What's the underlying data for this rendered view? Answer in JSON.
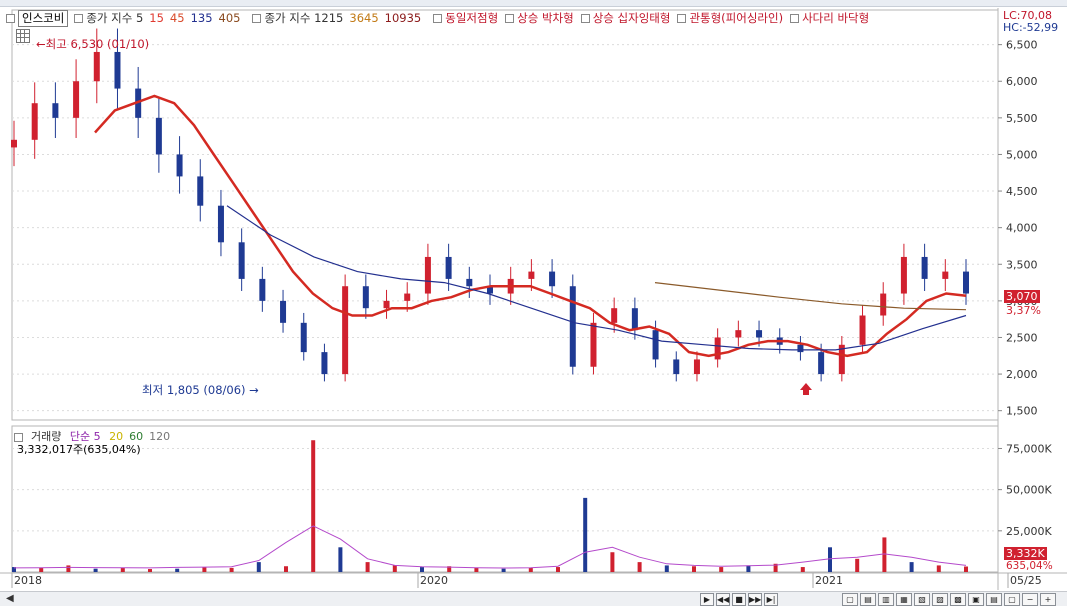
{
  "legend": {
    "stock_name": "인스코비",
    "price_ma_label": "종가 지수 5",
    "price_ma_periods": [
      {
        "label": "15",
        "color": "#e0392f"
      },
      {
        "label": "45",
        "color": "#d94a2a"
      },
      {
        "label": "135",
        "color": "#23308f"
      },
      {
        "label": "405",
        "color": "#8a4a1f"
      }
    ],
    "price_ma2_label": "종가 지수 1215",
    "price_ma2_periods": [
      {
        "label": "3645",
        "color": "#c27a15"
      },
      {
        "label": "10935",
        "color": "#8b1a1a"
      }
    ],
    "patterns": [
      "동일저점형",
      "상승 박차형",
      "상승 십자잉태형",
      "관통형(피어싱라인)",
      "사다리 바닥형"
    ]
  },
  "annotations": {
    "high": "최고 6,530 (01/10)",
    "low": "최저 1,805 (08/06)"
  },
  "right_axis": {
    "lc": "LC:70,08",
    "hc": "HC:-52,99",
    "price_ticks": [
      "6,500",
      "6,000",
      "5,500",
      "5,000",
      "4,500",
      "4,000",
      "3,500",
      "3,000",
      "2,500",
      "2,000",
      "1,500"
    ],
    "current_price": "3,070",
    "current_change": "3,37%",
    "volume_ticks": [
      "75,000K",
      "50,000K",
      "25,000K"
    ],
    "current_volume": "3,332K",
    "current_volume_ratio": "635,04%"
  },
  "volume_legend": {
    "label": "거래량",
    "ma_label": "단순 5",
    "periods": [
      {
        "label": "20",
        "color": "#c9b400"
      },
      {
        "label": "60",
        "color": "#2e7d32"
      },
      {
        "label": "120",
        "color": "#777777"
      }
    ],
    "value": "3,332,017주(635,04%)"
  },
  "x_axis": [
    "2018",
    "2020",
    "2021",
    "05/25"
  ],
  "colors": {
    "up": "#d0212f",
    "down": "#1f3a93",
    "ma_short": "#d42a22",
    "ma_mid": "#e07a20",
    "ma_long": "#23308f",
    "ma_very_long": "#8a5a2a"
  },
  "chart_data": {
    "type": "line",
    "title": "",
    "price_axis_range": [
      1400,
      6700
    ],
    "volume_axis_range": [
      0,
      85000
    ],
    "price_ticks": [
      6500,
      6000,
      5500,
      5000,
      4500,
      4000,
      3500,
      3000,
      2500,
      2000,
      1500
    ],
    "volume_ticks": [
      75000,
      50000,
      25000
    ],
    "series": [
      {
        "name": "종가",
        "values": [
          5200,
          5700,
          5500,
          6000,
          6400,
          5900,
          5500,
          5000,
          4700,
          4300,
          3800,
          3300,
          3000,
          2700,
          2300,
          2000,
          3200,
          2900,
          3000,
          3100,
          3600,
          3300,
          3200,
          3100,
          3300,
          3400,
          3200,
          2100,
          2700,
          2900,
          2600,
          2200,
          2000,
          2200,
          2500,
          2600,
          2500,
          2400,
          2300,
          2000,
          2400,
          2800,
          3100,
          3600,
          3300,
          3400,
          3100
        ]
      },
      {
        "name": "15",
        "values": [
          5300,
          5600,
          5700,
          5800,
          5700,
          5400,
          5000,
          4600,
          4200,
          3800,
          3400,
          3100,
          2900,
          2800,
          2800,
          2900,
          2900,
          3000,
          3050,
          3150,
          3200,
          3200,
          3200,
          3100,
          3000,
          2900,
          2700,
          2600,
          2650,
          2550,
          2300,
          2250,
          2300,
          2400,
          2450,
          2450,
          2400,
          2300,
          2250,
          2300,
          2550,
          2750,
          3000,
          3100,
          3070
        ]
      },
      {
        "name": "135",
        "values": [
          4300,
          3900,
          3600,
          3400,
          3300,
          3250,
          3100,
          2900,
          2700,
          2600,
          2450,
          2400,
          2350,
          2330,
          2330,
          2420,
          2620,
          2800
        ]
      },
      {
        "name": "405",
        "values": [
          3250,
          3150,
          3050,
          2960,
          2900,
          2880
        ]
      }
    ],
    "volume": {
      "name": "거래량",
      "values": [
        3000,
        2500,
        4000,
        2000,
        2500,
        1800,
        2000,
        3000,
        2500,
        6000,
        3500,
        80000,
        15000,
        6000,
        4000,
        3000,
        3500,
        2500,
        2000,
        2500,
        3000,
        45000,
        12000,
        6000,
        4000,
        3500,
        3000,
        4000,
        5000,
        3000,
        15000,
        8000,
        21000,
        6000,
        4000,
        3332
      ],
      "ma5": [
        2500,
        2600,
        2800,
        2700,
        2600,
        2500,
        2800,
        3000,
        3200,
        7000,
        18000,
        28000,
        20000,
        8000,
        4000,
        3200,
        3000,
        2600,
        2400,
        2600,
        3500,
        12000,
        15000,
        9000,
        5000,
        4000,
        3500,
        3800,
        4200,
        6000,
        8000,
        9000,
        11000,
        9000,
        6000,
        4000
      ]
    }
  }
}
